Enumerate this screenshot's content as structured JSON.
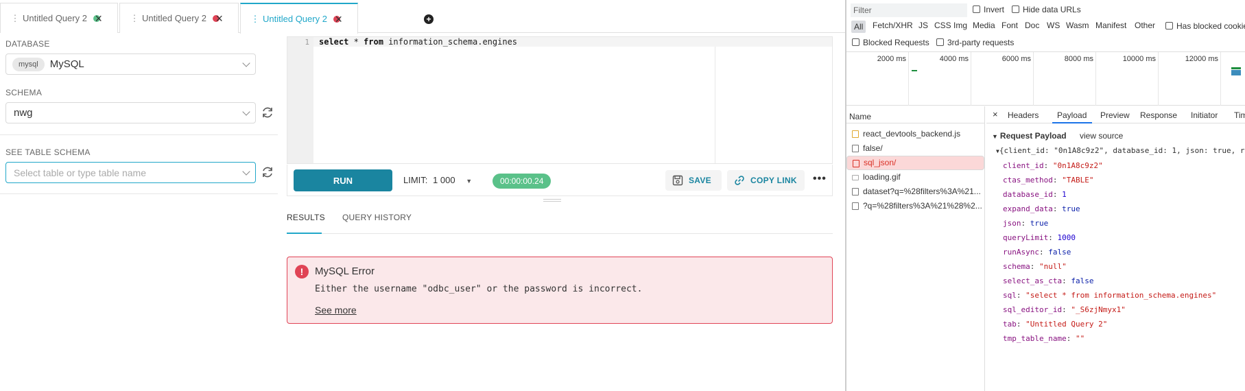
{
  "tabs": [
    {
      "label": "Untitled Query 2",
      "status_color": "#5ac189"
    },
    {
      "label": "Untitled Query 2",
      "status_color": "#e04355"
    },
    {
      "label": "Untitled Query 2",
      "status_color": "#e04355"
    }
  ],
  "sidebar": {
    "database_label": "DATABASE",
    "database_badge": "mysql",
    "database_value": "MySQL",
    "schema_label": "SCHEMA",
    "schema_value": "nwg",
    "table_label": "SEE TABLE SCHEMA",
    "table_placeholder": "Select table or type table name"
  },
  "editor": {
    "line_number": "1",
    "kw1": "select",
    "mid": " * ",
    "kw2": "from",
    "rest": " information_schema.engines"
  },
  "toolbar": {
    "run_label": "RUN",
    "limit_label": "LIMIT:",
    "limit_value": "1 000",
    "timer": "00:00:00.24",
    "save_label": "SAVE",
    "copy_link_label": "COPY LINK",
    "more": "•••"
  },
  "results_tabs": {
    "results": "RESULTS",
    "history": "QUERY HISTORY"
  },
  "error": {
    "icon": "!",
    "title": "MySQL Error",
    "message": "Either the username \"odbc_user\" or the password is incorrect.",
    "see_more": "See more"
  },
  "devtools": {
    "filter_placeholder": "Filter",
    "invert": "Invert",
    "hide_data_urls": "Hide data URLs",
    "types": [
      "All",
      "Fetch/XHR",
      "JS",
      "CSS",
      "Img",
      "Media",
      "Font",
      "Doc",
      "WS",
      "Wasm",
      "Manifest",
      "Other"
    ],
    "has_blocked_cookies": "Has blocked cookies",
    "blocked_requests": "Blocked Requests",
    "third_party": "3rd-party requests",
    "timeline_ticks": [
      "2000 ms",
      "4000 ms",
      "6000 ms",
      "8000 ms",
      "10000 ms",
      "12000 ms"
    ],
    "name_header": "Name",
    "requests": [
      "react_devtools_backend.js",
      "false/",
      "sql_json/",
      "loading.gif",
      "dataset?q=%28filters%3A%21...",
      "?q=%28filters%3A%21%28%2..."
    ],
    "detail_tabs": [
      "×",
      "Headers",
      "Payload",
      "Preview",
      "Response",
      "Initiator",
      "Timing"
    ],
    "payload_title": "Request Payload",
    "view_source": "view source",
    "payload_summary": "{client_id: \"0n1A8c9z2\", database_id: 1, json: true, r",
    "payload": [
      {
        "key": "client_id",
        "value": "\"0n1A8c9z2\"",
        "kind": "str"
      },
      {
        "key": "ctas_method",
        "value": "\"TABLE\"",
        "kind": "str"
      },
      {
        "key": "database_id",
        "value": "1",
        "kind": "num"
      },
      {
        "key": "expand_data",
        "value": "true",
        "kind": "bool"
      },
      {
        "key": "json",
        "value": "true",
        "kind": "bool"
      },
      {
        "key": "queryLimit",
        "value": "1000",
        "kind": "num"
      },
      {
        "key": "runAsync",
        "value": "false",
        "kind": "bool"
      },
      {
        "key": "schema",
        "value": "\"null\"",
        "kind": "str"
      },
      {
        "key": "select_as_cta",
        "value": "false",
        "kind": "bool"
      },
      {
        "key": "sql",
        "value": "\"select * from information_schema.engines\"",
        "kind": "str"
      },
      {
        "key": "sql_editor_id",
        "value": "\"_S6zjNmyx1\"",
        "kind": "str"
      },
      {
        "key": "tab",
        "value": "\"Untitled Query 2\"",
        "kind": "str"
      },
      {
        "key": "tmp_table_name",
        "value": "\"\"",
        "kind": "str"
      }
    ]
  },
  "colors": {
    "accent": "#20a7c9",
    "run_button": "#1a85a0",
    "success": "#5ac189",
    "error": "#e04355"
  }
}
